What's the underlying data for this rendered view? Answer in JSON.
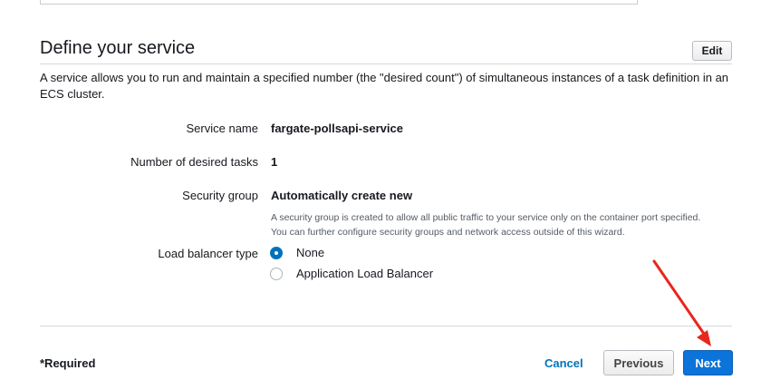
{
  "section": {
    "title": "Define your service",
    "edit_label": "Edit",
    "description": "A service allows you to run and maintain a specified number (the \"desired count\") of simultaneous instances of a task definition in an ECS cluster."
  },
  "fields": {
    "service_name": {
      "label": "Service name",
      "value": "fargate-pollsapi-service"
    },
    "desired_tasks": {
      "label": "Number of desired tasks",
      "value": "1"
    },
    "security_group": {
      "label": "Security group",
      "value": "Automatically create new",
      "help_line1": "A security group is created to allow all public traffic to your service only on the container port specified.",
      "help_line2": "You can further configure security groups and network access outside of this wizard."
    },
    "load_balancer": {
      "label": "Load balancer type",
      "options": [
        {
          "label": "None",
          "selected": true
        },
        {
          "label": "Application Load Balancer",
          "selected": false
        }
      ]
    }
  },
  "footer": {
    "required_label": "*Required",
    "cancel_label": "Cancel",
    "previous_label": "Previous",
    "next_label": "Next"
  },
  "colors": {
    "accent": "#0073bb",
    "primary_button": "#0b73da",
    "annotation_arrow": "#e8271e"
  }
}
